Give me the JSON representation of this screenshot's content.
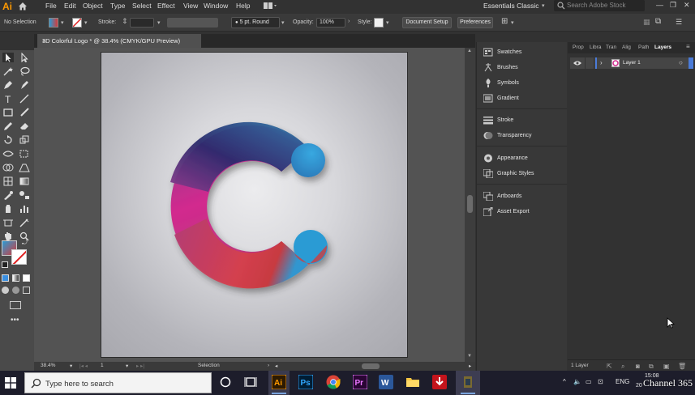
{
  "app": {
    "logo": "Ai",
    "menu": [
      "File",
      "Edit",
      "Object",
      "Type",
      "Select",
      "Effect",
      "View",
      "Window",
      "Help"
    ],
    "workspace": "Essentials Classic",
    "stock_search_placeholder": "Search Adobe Stock"
  },
  "control_bar": {
    "selection_label": "No Selection",
    "stroke_label": "Stroke:",
    "brush_label": "5 pt. Round",
    "opacity_label": "Opacity:",
    "opacity_value": "100%",
    "style_label": "Style:",
    "document_setup": "Document Setup",
    "preferences": "Preferences"
  },
  "document": {
    "tab_title": "3D Colorful Logo * @ 38.4% (CMYK/GPU Preview)",
    "close": "×"
  },
  "status_bar": {
    "zoom": "38.4%",
    "artboard": "1",
    "tool": "Selection"
  },
  "panels": [
    {
      "icon": "swatches-icon",
      "label": "Swatches"
    },
    {
      "icon": "brushes-icon",
      "label": "Brushes"
    },
    {
      "icon": "symbols-icon",
      "label": "Symbols"
    },
    {
      "icon": "gradient-icon",
      "label": "Gradient"
    },
    {
      "icon": "stroke-icon",
      "label": "Stroke"
    },
    {
      "icon": "transparency-icon",
      "label": "Transparency"
    },
    {
      "icon": "appearance-icon",
      "label": "Appearance"
    },
    {
      "icon": "graphic-styles-icon",
      "label": "Graphic Styles"
    },
    {
      "icon": "artboards-icon",
      "label": "Artboards"
    },
    {
      "icon": "asset-export-icon",
      "label": "Asset Export"
    }
  ],
  "layers_panel": {
    "tabs": [
      "Prop",
      "Libra",
      "Tran",
      "Alig",
      "Path",
      "Layers"
    ],
    "active_tab": "Layers",
    "layer_name": "Layer 1",
    "footer": "1 Layer"
  },
  "taskbar": {
    "search_placeholder": "Type here to search",
    "apps": [
      "task-view",
      "illustrator",
      "photoshop",
      "chrome",
      "premiere",
      "word",
      "file-explorer",
      "downloader",
      "app-unknown"
    ],
    "language": "ENG",
    "time": "15:08",
    "date": "20",
    "watermark": "Channel 365"
  },
  "colors": {
    "accent": "#ff9a00",
    "layer_color": "#4a7bd8",
    "logo_top": "#2b2d6e",
    "logo_left": "#d62f8a",
    "logo_bottom": "#d43a3a",
    "logo_cap_blue": "#2a9bd4"
  }
}
